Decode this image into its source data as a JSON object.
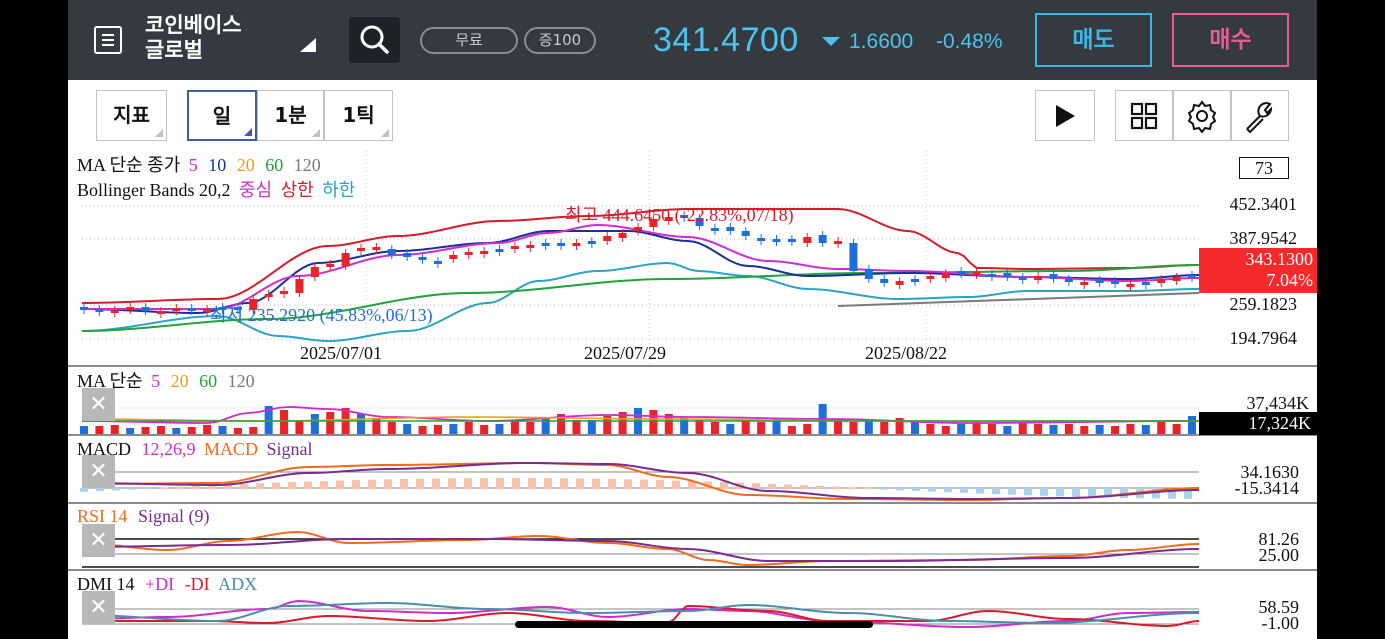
{
  "header": {
    "exchange_line1": "코인베이스",
    "exchange_line2": "글로벌",
    "pill_free": "무료",
    "pill_margin": "증100",
    "price": "341.4700",
    "change": "1.6600",
    "change_pct": "-0.48%",
    "sell_label": "매도",
    "buy_label": "매수"
  },
  "toolbar": {
    "indicator_label": "지표",
    "period_day": "일",
    "period_1min": "1분",
    "period_1tick": "1틱"
  },
  "colors": {
    "up": "#e8232a",
    "down": "#1e6fd9",
    "ma5": "#d02ccf",
    "ma10": "#1a2f9a",
    "ma20": "#f29a1c",
    "ma60": "#22a13c",
    "ma120": "#7a7a7a",
    "bb_mid": "#d02ccf",
    "bb_up": "#d81b2a",
    "bb_low": "#2aa3c4"
  },
  "main_panel": {
    "ma_legend": {
      "title": "MA 단순 종가",
      "p1": "5",
      "p2": "10",
      "p3": "20",
      "p4": "60",
      "p5": "120"
    },
    "bb_legend": {
      "title": "Bollinger Bands 20,2",
      "mid": "중심",
      "up": "상한",
      "low": "하한"
    },
    "y_labels": [
      "452.3401",
      "387.9542",
      "259.1823",
      "194.7964"
    ],
    "count_box": "73",
    "price_tag": "343.1300",
    "price_tag_pct": "7.04%",
    "high_annotation": "최고 444.6450 (-22.83%,07/18)",
    "low_annotation": "최저 235.2920 (45.83%,06/13)",
    "x_labels": [
      "2025/07/01",
      "2025/07/29",
      "2025/08/22"
    ]
  },
  "volume_panel": {
    "title": "MA 단순",
    "p1": "5",
    "p2": "20",
    "p3": "60",
    "p4": "120",
    "y_top": "37,434K",
    "current": "17,324K"
  },
  "macd_panel": {
    "title": "MACD",
    "params": "12,26,9",
    "macd": "MACD",
    "signal": "Signal",
    "y_top": "34.1630",
    "y_bottom": "-15.3414"
  },
  "rsi_panel": {
    "title": "RSI 14",
    "signal": "Signal (9)",
    "y_top": "81.26",
    "y_bottom": "25.00"
  },
  "dmi_panel": {
    "title": "DMI 14",
    "pdi": "+DI",
    "mdi": "-DI",
    "adx": "ADX",
    "y_top": "58.59",
    "y_bottom": "-1.00"
  }
}
